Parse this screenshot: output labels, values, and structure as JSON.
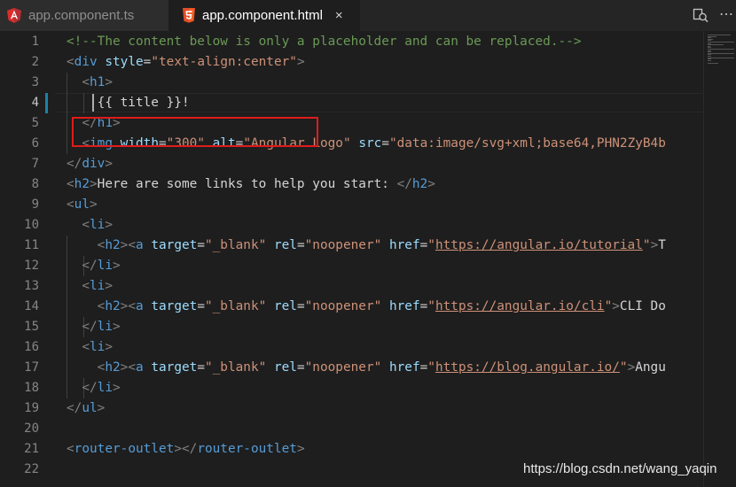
{
  "tabs": [
    {
      "label": "app.component.ts",
      "icon": "angular-icon",
      "active": false
    },
    {
      "label": "app.component.html",
      "icon": "html5-icon",
      "active": true,
      "close": "×"
    }
  ],
  "toolbar": {
    "split_icon": "split-editor-icon",
    "more": "⋯"
  },
  "editor": {
    "current_line": 4,
    "line_numbers": [
      "1",
      "2",
      "3",
      "4",
      "5",
      "6",
      "7",
      "8",
      "9",
      "10",
      "11",
      "12",
      "13",
      "14",
      "15",
      "16",
      "17",
      "18",
      "19",
      "20",
      "21",
      "22"
    ],
    "lines": [
      [
        {
          "t": "comment",
          "v": "<!--The content below is only a placeholder and can be replaced.-->"
        }
      ],
      [
        {
          "t": "bracket",
          "v": "<"
        },
        {
          "t": "tag",
          "v": "div"
        },
        {
          "t": "text",
          "v": " "
        },
        {
          "t": "attr",
          "v": "style"
        },
        {
          "t": "text",
          "v": "="
        },
        {
          "t": "str",
          "v": "\"text-align:center\""
        },
        {
          "t": "bracket",
          "v": ">"
        }
      ],
      [
        {
          "t": "text",
          "v": "  "
        },
        {
          "t": "bracket",
          "v": "<"
        },
        {
          "t": "tag",
          "v": "h1"
        },
        {
          "t": "bracket",
          "v": ">"
        }
      ],
      [
        {
          "t": "text",
          "v": "    {{ title }}!"
        }
      ],
      [
        {
          "t": "text",
          "v": "  "
        },
        {
          "t": "bracket",
          "v": "</"
        },
        {
          "t": "tag",
          "v": "h1"
        },
        {
          "t": "bracket",
          "v": ">"
        }
      ],
      [
        {
          "t": "text",
          "v": "  "
        },
        {
          "t": "bracket",
          "v": "<"
        },
        {
          "t": "tag",
          "v": "img"
        },
        {
          "t": "text",
          "v": " "
        },
        {
          "t": "attr",
          "v": "width"
        },
        {
          "t": "text",
          "v": "="
        },
        {
          "t": "str",
          "v": "\"300\""
        },
        {
          "t": "text",
          "v": " "
        },
        {
          "t": "attr",
          "v": "alt"
        },
        {
          "t": "text",
          "v": "="
        },
        {
          "t": "str",
          "v": "\"Angular Logo\""
        },
        {
          "t": "text",
          "v": " "
        },
        {
          "t": "attr",
          "v": "src"
        },
        {
          "t": "text",
          "v": "="
        },
        {
          "t": "str",
          "v": "\"data:image/svg+xml;base64,PHN2ZyB4b"
        }
      ],
      [
        {
          "t": "bracket",
          "v": "</"
        },
        {
          "t": "tag",
          "v": "div"
        },
        {
          "t": "bracket",
          "v": ">"
        }
      ],
      [
        {
          "t": "bracket",
          "v": "<"
        },
        {
          "t": "tag",
          "v": "h2"
        },
        {
          "t": "bracket",
          "v": ">"
        },
        {
          "t": "text",
          "v": "Here are some links to help you start: "
        },
        {
          "t": "bracket",
          "v": "</"
        },
        {
          "t": "tag",
          "v": "h2"
        },
        {
          "t": "bracket",
          "v": ">"
        }
      ],
      [
        {
          "t": "bracket",
          "v": "<"
        },
        {
          "t": "tag",
          "v": "ul"
        },
        {
          "t": "bracket",
          "v": ">"
        }
      ],
      [
        {
          "t": "text",
          "v": "  "
        },
        {
          "t": "bracket",
          "v": "<"
        },
        {
          "t": "tag",
          "v": "li"
        },
        {
          "t": "bracket",
          "v": ">"
        }
      ],
      [
        {
          "t": "text",
          "v": "    "
        },
        {
          "t": "bracket",
          "v": "<"
        },
        {
          "t": "tag",
          "v": "h2"
        },
        {
          "t": "bracket",
          "v": "><"
        },
        {
          "t": "tag",
          "v": "a"
        },
        {
          "t": "text",
          "v": " "
        },
        {
          "t": "attr",
          "v": "target"
        },
        {
          "t": "text",
          "v": "="
        },
        {
          "t": "str",
          "v": "\"_blank\""
        },
        {
          "t": "text",
          "v": " "
        },
        {
          "t": "attr",
          "v": "rel"
        },
        {
          "t": "text",
          "v": "="
        },
        {
          "t": "str",
          "v": "\"noopener\""
        },
        {
          "t": "text",
          "v": " "
        },
        {
          "t": "attr",
          "v": "href"
        },
        {
          "t": "text",
          "v": "="
        },
        {
          "t": "str",
          "v": "\""
        },
        {
          "t": "url",
          "v": "https://angular.io/tutorial"
        },
        {
          "t": "str",
          "v": "\""
        },
        {
          "t": "bracket",
          "v": ">"
        },
        {
          "t": "text",
          "v": "T"
        }
      ],
      [
        {
          "t": "text",
          "v": "  "
        },
        {
          "t": "bracket",
          "v": "</"
        },
        {
          "t": "tag",
          "v": "li"
        },
        {
          "t": "bracket",
          "v": ">"
        }
      ],
      [
        {
          "t": "text",
          "v": "  "
        },
        {
          "t": "bracket",
          "v": "<"
        },
        {
          "t": "tag",
          "v": "li"
        },
        {
          "t": "bracket",
          "v": ">"
        }
      ],
      [
        {
          "t": "text",
          "v": "    "
        },
        {
          "t": "bracket",
          "v": "<"
        },
        {
          "t": "tag",
          "v": "h2"
        },
        {
          "t": "bracket",
          "v": "><"
        },
        {
          "t": "tag",
          "v": "a"
        },
        {
          "t": "text",
          "v": " "
        },
        {
          "t": "attr",
          "v": "target"
        },
        {
          "t": "text",
          "v": "="
        },
        {
          "t": "str",
          "v": "\"_blank\""
        },
        {
          "t": "text",
          "v": " "
        },
        {
          "t": "attr",
          "v": "rel"
        },
        {
          "t": "text",
          "v": "="
        },
        {
          "t": "str",
          "v": "\"noopener\""
        },
        {
          "t": "text",
          "v": " "
        },
        {
          "t": "attr",
          "v": "href"
        },
        {
          "t": "text",
          "v": "="
        },
        {
          "t": "str",
          "v": "\""
        },
        {
          "t": "url",
          "v": "https://angular.io/cli"
        },
        {
          "t": "str",
          "v": "\""
        },
        {
          "t": "bracket",
          "v": ">"
        },
        {
          "t": "text",
          "v": "CLI Do"
        }
      ],
      [
        {
          "t": "text",
          "v": "  "
        },
        {
          "t": "bracket",
          "v": "</"
        },
        {
          "t": "tag",
          "v": "li"
        },
        {
          "t": "bracket",
          "v": ">"
        }
      ],
      [
        {
          "t": "text",
          "v": "  "
        },
        {
          "t": "bracket",
          "v": "<"
        },
        {
          "t": "tag",
          "v": "li"
        },
        {
          "t": "bracket",
          "v": ">"
        }
      ],
      [
        {
          "t": "text",
          "v": "    "
        },
        {
          "t": "bracket",
          "v": "<"
        },
        {
          "t": "tag",
          "v": "h2"
        },
        {
          "t": "bracket",
          "v": "><"
        },
        {
          "t": "tag",
          "v": "a"
        },
        {
          "t": "text",
          "v": " "
        },
        {
          "t": "attr",
          "v": "target"
        },
        {
          "t": "text",
          "v": "="
        },
        {
          "t": "str",
          "v": "\"_blank\""
        },
        {
          "t": "text",
          "v": " "
        },
        {
          "t": "attr",
          "v": "rel"
        },
        {
          "t": "text",
          "v": "="
        },
        {
          "t": "str",
          "v": "\"noopener\""
        },
        {
          "t": "text",
          "v": " "
        },
        {
          "t": "attr",
          "v": "href"
        },
        {
          "t": "text",
          "v": "="
        },
        {
          "t": "str",
          "v": "\""
        },
        {
          "t": "url",
          "v": "https://blog.angular.io/"
        },
        {
          "t": "str",
          "v": "\""
        },
        {
          "t": "bracket",
          "v": ">"
        },
        {
          "t": "text",
          "v": "Angu"
        }
      ],
      [
        {
          "t": "text",
          "v": "  "
        },
        {
          "t": "bracket",
          "v": "</"
        },
        {
          "t": "tag",
          "v": "li"
        },
        {
          "t": "bracket",
          "v": ">"
        }
      ],
      [
        {
          "t": "bracket",
          "v": "</"
        },
        {
          "t": "tag",
          "v": "ul"
        },
        {
          "t": "bracket",
          "v": ">"
        }
      ],
      [],
      [
        {
          "t": "bracket",
          "v": "<"
        },
        {
          "t": "tag",
          "v": "router-outlet"
        },
        {
          "t": "bracket",
          "v": "></"
        },
        {
          "t": "tag",
          "v": "router-outlet"
        },
        {
          "t": "bracket",
          "v": ">"
        }
      ],
      []
    ]
  },
  "watermark": "https://blog.csdn.net/wang_yaqin",
  "colors": {
    "background": "#1e1e1e",
    "tab_bar": "#252526",
    "annotation_box": "#e01b1b",
    "comment": "#6a9955",
    "tag": "#569cd6",
    "attribute": "#9cdcfe",
    "string": "#ce9178"
  }
}
